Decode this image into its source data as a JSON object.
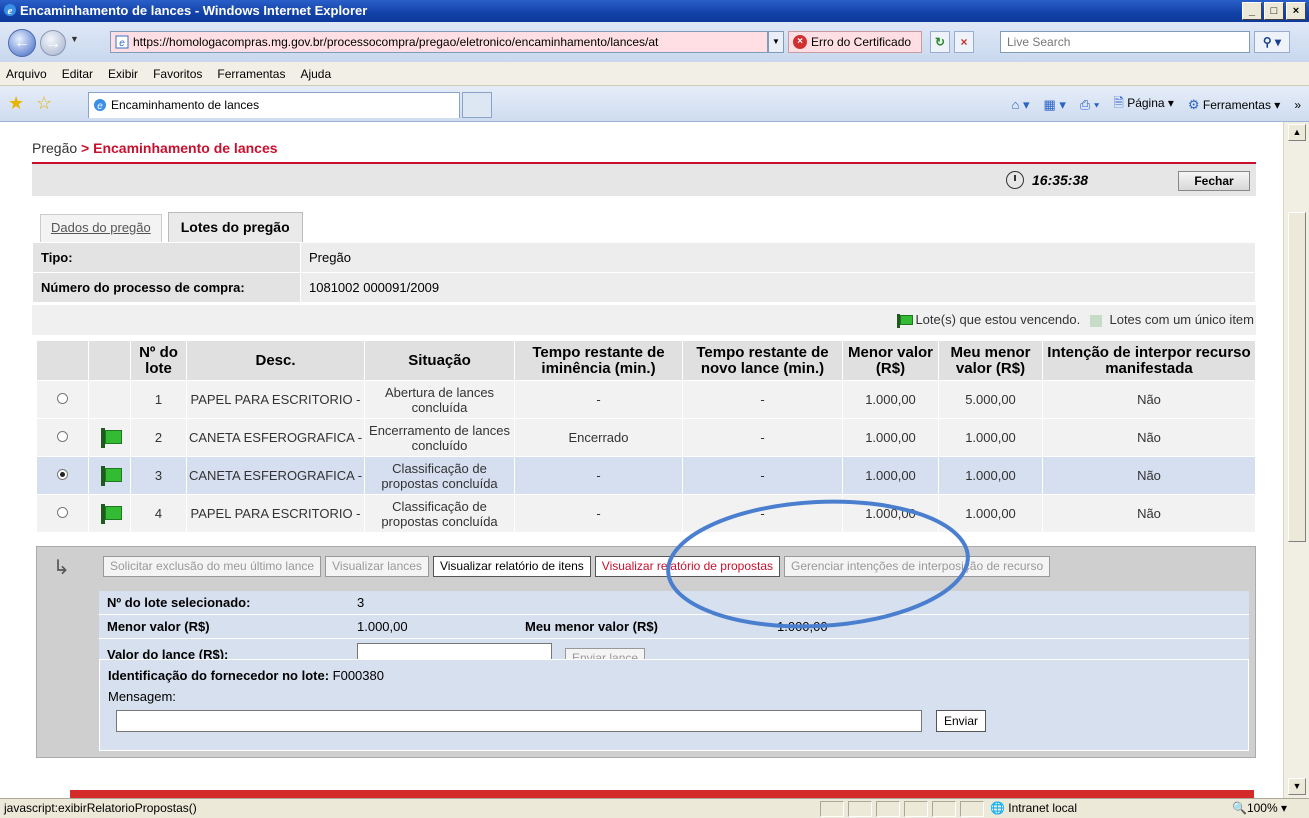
{
  "window": {
    "title": "Encaminhamento de lances - Windows Internet Explorer",
    "controls": [
      "_",
      "□",
      "×"
    ]
  },
  "address": {
    "url": "https://homologacompras.mg.gov.br/processocompra/pregao/eletronico/encaminhamento/lances/at",
    "cert_error": "Erro do Certificado",
    "search_placeholder": "Live Search"
  },
  "menu": [
    "Arquivo",
    "Editar",
    "Exibir",
    "Favoritos",
    "Ferramentas",
    "Ajuda"
  ],
  "browser_tab": {
    "label": "Encaminhamento de lances"
  },
  "command_bar": {
    "page": "Página",
    "tools": "Ferramentas"
  },
  "page": {
    "breadcrumb_root": "Pregão",
    "breadcrumb_sep": " > ",
    "breadcrumb_current": "Encaminhamento de lances",
    "clock": "16:35:38",
    "close_button": "Fechar",
    "tabs": [
      "Dados do pregão",
      "Lotes do pregão"
    ],
    "tipo_label": "Tipo:",
    "tipo_value": "Pregão",
    "processo_label": "Número do processo de compra:",
    "processo_value": "1081002 000091/2009",
    "legend_winning": "Lote(s) que estou vencendo.",
    "legend_single": "Lotes com um único item"
  },
  "lots_table": {
    "headers": [
      "Nº do lote",
      "Desc.",
      "Situação",
      "Tempo restante de iminência (min.)",
      "Tempo restante de novo lance (min.)",
      "Menor valor (R$)",
      "Meu menor valor (R$)",
      "Intenção de interpor recurso manifestada"
    ],
    "rows": [
      {
        "selected": false,
        "flag": false,
        "lote": "1",
        "desc": "PAPEL PARA ESCRITORIO -",
        "situacao": "Abertura de lances concluída",
        "iminencia": "-",
        "novo_lance": "-",
        "menor": "1.000,00",
        "meu_menor": "5.000,00",
        "recurso": "Não"
      },
      {
        "selected": false,
        "flag": true,
        "lote": "2",
        "desc": "CANETA ESFEROGRAFICA -",
        "situacao": "Encerramento de lances concluído",
        "iminencia": "Encerrado",
        "novo_lance": "-",
        "menor": "1.000,00",
        "meu_menor": "1.000,00",
        "recurso": "Não"
      },
      {
        "selected": true,
        "flag": true,
        "lote": "3",
        "desc": "CANETA ESFEROGRAFICA -",
        "situacao": "Classificação de propostas concluída",
        "iminencia": "-",
        "novo_lance": "-",
        "menor": "1.000,00",
        "meu_menor": "1.000,00",
        "recurso": "Não"
      },
      {
        "selected": false,
        "flag": true,
        "lote": "4",
        "desc": "PAPEL PARA ESCRITORIO -",
        "situacao": "Classificação de propostas concluída",
        "iminencia": "-",
        "novo_lance": "-",
        "menor": "1.000,00",
        "meu_menor": "1.000,00",
        "recurso": "Não"
      }
    ]
  },
  "actions": {
    "excluir": "Solicitar exclusão do meu último lance",
    "visualizar_lances": "Visualizar lances",
    "relatorio_itens": "Visualizar relatório de itens",
    "relatorio_propostas": "Visualizar relatório de propostas",
    "gerenciar": "Gerenciar intenções de interposição de recurso"
  },
  "detail": {
    "lote_label": "Nº do lote selecionado:",
    "lote_value": "3",
    "menor_label": "Menor valor (R$)",
    "menor_value": "1.000,00",
    "meu_label": "Meu menor valor (R$)",
    "meu_value": "1.000,00",
    "lance_label": "Valor do lance (R$):",
    "lance_value": "",
    "enviar_lance": "Enviar lance",
    "ident_label": "Identificação do fornecedor no lote:",
    "ident_value": "F000380",
    "mensagem_label": "Mensagem:",
    "mensagem_value": "",
    "enviar": "Enviar"
  },
  "statusbar": {
    "text": "javascript:exibirRelatorioPropostas()",
    "zone": "Intranet local",
    "zoom": "100%"
  },
  "colors": {
    "accent_red": "#c8102e",
    "annotation_ellipse": "#4a7fd0",
    "selected_row": "#d6dff0"
  }
}
